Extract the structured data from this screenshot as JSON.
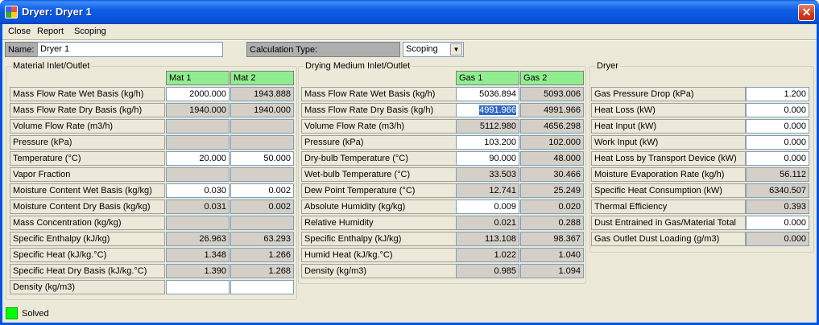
{
  "window": {
    "title": "Dryer: Dryer 1",
    "close_glyph": "✕"
  },
  "menu": [
    "Close",
    "Report",
    "Scoping"
  ],
  "name_label": "Name:",
  "name_value": "Dryer 1",
  "calc_type_label": "Calculation Type:",
  "calc_type_value": "Scoping",
  "material": {
    "title": "Material Inlet/Outlet",
    "columns": [
      "Mat 1",
      "Mat 2"
    ],
    "rows": [
      {
        "label": "Mass Flow Rate Wet Basis (kg/h)",
        "cells": [
          {
            "v": "2000.000",
            "t": "w"
          },
          {
            "v": "1943.888",
            "t": "g"
          }
        ]
      },
      {
        "label": "Mass Flow Rate Dry Basis (kg/h)",
        "cells": [
          {
            "v": "1940.000",
            "t": "g"
          },
          {
            "v": "1940.000",
            "t": "g"
          }
        ]
      },
      {
        "label": "Volume Flow Rate (m3/h)",
        "cells": [
          {
            "v": "",
            "t": "g"
          },
          {
            "v": "",
            "t": "g"
          }
        ]
      },
      {
        "label": "Pressure (kPa)",
        "cells": [
          {
            "v": "",
            "t": "g"
          },
          {
            "v": "",
            "t": "g"
          }
        ]
      },
      {
        "label": "Temperature (°C)",
        "cells": [
          {
            "v": "20.000",
            "t": "w"
          },
          {
            "v": "50.000",
            "t": "w"
          }
        ]
      },
      {
        "label": "Vapor Fraction",
        "cells": [
          {
            "v": "",
            "t": "g"
          },
          {
            "v": "",
            "t": "g"
          }
        ]
      },
      {
        "label": "Moisture Content Wet Basis (kg/kg)",
        "cells": [
          {
            "v": "0.030",
            "t": "w"
          },
          {
            "v": "0.002",
            "t": "w"
          }
        ]
      },
      {
        "label": "Moisture Content Dry Basis (kg/kg)",
        "cells": [
          {
            "v": "0.031",
            "t": "g"
          },
          {
            "v": "0.002",
            "t": "g"
          }
        ]
      },
      {
        "label": "Mass Concentration (kg/kg)",
        "cells": [
          {
            "v": "",
            "t": "g"
          },
          {
            "v": "",
            "t": "g"
          }
        ]
      },
      {
        "label": "Specific Enthalpy (kJ/kg)",
        "cells": [
          {
            "v": "26.963",
            "t": "g"
          },
          {
            "v": "63.293",
            "t": "g"
          }
        ]
      },
      {
        "label": "Specific Heat (kJ/kg.°C)",
        "cells": [
          {
            "v": "1.348",
            "t": "g"
          },
          {
            "v": "1.266",
            "t": "g"
          }
        ]
      },
      {
        "label": "Specific Heat Dry Basis (kJ/kg.°C)",
        "cells": [
          {
            "v": "1.390",
            "t": "g"
          },
          {
            "v": "1.268",
            "t": "g"
          }
        ]
      },
      {
        "label": "Density (kg/m3)",
        "cells": [
          {
            "v": "",
            "t": "w"
          },
          {
            "v": "",
            "t": "w"
          }
        ]
      }
    ]
  },
  "gas": {
    "title": "Drying Medium Inlet/Outlet",
    "columns": [
      "Gas 1",
      "Gas 2"
    ],
    "rows": [
      {
        "label": "Mass Flow Rate Wet Basis (kg/h)",
        "cells": [
          {
            "v": "5036.894",
            "t": "w"
          },
          {
            "v": "5093.006",
            "t": "g"
          }
        ]
      },
      {
        "label": "Mass Flow Rate Dry Basis (kg/h)",
        "cells": [
          {
            "v": "4991.966",
            "t": "s"
          },
          {
            "v": "4991.966",
            "t": "g"
          }
        ]
      },
      {
        "label": "Volume Flow Rate (m3/h)",
        "cells": [
          {
            "v": "5112.980",
            "t": "g"
          },
          {
            "v": "4656.298",
            "t": "g"
          }
        ]
      },
      {
        "label": "Pressure (kPa)",
        "cells": [
          {
            "v": "103.200",
            "t": "w"
          },
          {
            "v": "102.000",
            "t": "g"
          }
        ]
      },
      {
        "label": "Dry-bulb Temperature (°C)",
        "cells": [
          {
            "v": "90.000",
            "t": "w"
          },
          {
            "v": "48.000",
            "t": "g"
          }
        ]
      },
      {
        "label": "Wet-bulb Temperature (°C)",
        "cells": [
          {
            "v": "33.503",
            "t": "g"
          },
          {
            "v": "30.466",
            "t": "g"
          }
        ]
      },
      {
        "label": "Dew Point Temperature (°C)",
        "cells": [
          {
            "v": "12.741",
            "t": "g"
          },
          {
            "v": "25.249",
            "t": "g"
          }
        ]
      },
      {
        "label": "Absolute Humidity (kg/kg)",
        "cells": [
          {
            "v": "0.009",
            "t": "w"
          },
          {
            "v": "0.020",
            "t": "g"
          }
        ]
      },
      {
        "label": "Relative Humidity",
        "cells": [
          {
            "v": "0.021",
            "t": "g"
          },
          {
            "v": "0.288",
            "t": "g"
          }
        ]
      },
      {
        "label": "Specific Enthalpy (kJ/kg)",
        "cells": [
          {
            "v": "113.108",
            "t": "g"
          },
          {
            "v": "98.367",
            "t": "g"
          }
        ]
      },
      {
        "label": "Humid Heat (kJ/kg.°C)",
        "cells": [
          {
            "v": "1.022",
            "t": "g"
          },
          {
            "v": "1.040",
            "t": "g"
          }
        ]
      },
      {
        "label": "Density (kg/m3)",
        "cells": [
          {
            "v": "0.985",
            "t": "g"
          },
          {
            "v": "1.094",
            "t": "g"
          }
        ]
      }
    ]
  },
  "dryer": {
    "title": "Dryer",
    "rows": [
      {
        "label": "Gas Pressure Drop (kPa)",
        "v": "1.200",
        "t": "w"
      },
      {
        "label": "Heat Loss (kW)",
        "v": "0.000",
        "t": "w"
      },
      {
        "label": "Heat Input (kW)",
        "v": "0.000",
        "t": "w"
      },
      {
        "label": "Work Input (kW)",
        "v": "0.000",
        "t": "w"
      },
      {
        "label": "Heat Loss by Transport Device (kW)",
        "v": "0.000",
        "t": "w"
      },
      {
        "label": "Moisture Evaporation Rate (kg/h)",
        "v": "56.112",
        "t": "g"
      },
      {
        "label": "Specific Heat Consumption (kW)",
        "v": "6340.507",
        "t": "g"
      },
      {
        "label": "Thermal Efficiency",
        "v": "0.393",
        "t": "g"
      },
      {
        "label": "Dust Entrained in Gas/Material Total",
        "v": "0.000",
        "t": "w"
      },
      {
        "label": "Gas Outlet Dust Loading (g/m3)",
        "v": "0.000",
        "t": "g"
      }
    ]
  },
  "status": "Solved"
}
